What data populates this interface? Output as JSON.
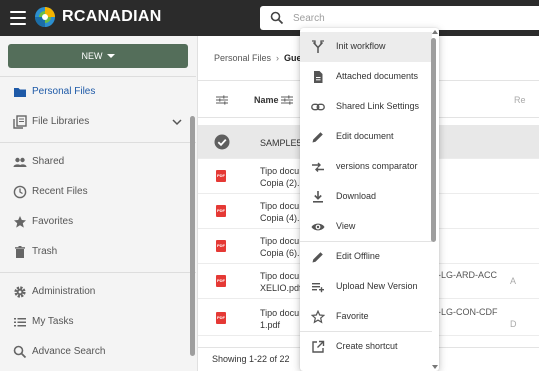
{
  "colors": {
    "header_bg": "#2b2b2b",
    "new_button_bg": "#546e5a",
    "active_nav": "#1e5aa8",
    "pdf_red": "#e53935"
  },
  "header": {
    "brand": "RCANADIAN",
    "search_placeholder": "Search"
  },
  "sidebar": {
    "new_button": "NEW",
    "items": [
      {
        "label": "Personal Files",
        "icon": "folder-icon",
        "active": true
      },
      {
        "label": "File Libraries",
        "icon": "library-icon",
        "expandable": true
      },
      {
        "label": "Shared",
        "icon": "people-icon"
      },
      {
        "label": "Recent Files",
        "icon": "clock-icon"
      },
      {
        "label": "Favorites",
        "icon": "star-icon"
      },
      {
        "label": "Trash",
        "icon": "trash-icon"
      },
      {
        "label": "Administration",
        "icon": "gear-icon"
      },
      {
        "label": "My Tasks",
        "icon": "task-list-icon"
      },
      {
        "label": "Advance Search",
        "icon": "search-icon"
      }
    ]
  },
  "content": {
    "breadcrumb": {
      "root": "Personal Files",
      "current": "Gue"
    },
    "table": {
      "header_name": "Name",
      "header_right": "Re",
      "rows": [
        {
          "name_line1": "SAMPLE5",
          "name_line2": "",
          "extra": "",
          "letter": "",
          "selected": true
        },
        {
          "name_line1": "Tipo docu",
          "name_line2": "Copia (2).p",
          "extra": "",
          "letter": ""
        },
        {
          "name_line1": "Tipo docu",
          "name_line2": "Copia (4).p",
          "extra": "",
          "letter": ""
        },
        {
          "name_line1": "Tipo docu",
          "name_line2": "Copia (6).p",
          "extra": "",
          "letter": ""
        },
        {
          "name_line1": "Tipo docu",
          "name_line2": "XELIO.pdf",
          "extra": "-LG-ARD-ACC",
          "letter": "A"
        },
        {
          "name_line1": "Tipo docu",
          "name_line2": "1.pdf",
          "extra": "-LG-CON-CDF",
          "letter": "D"
        }
      ]
    },
    "footer": "Showing 1-22 of 22"
  },
  "context_menu": {
    "items": [
      {
        "label": "Init workflow",
        "icon": "workflow-fork-icon"
      },
      {
        "label": "Attached documents",
        "icon": "document-icon"
      },
      {
        "label": "Shared Link Settings",
        "icon": "link-icon"
      },
      {
        "label": "Edit document",
        "icon": "pencil-icon"
      },
      {
        "label": "versions comparator",
        "icon": "compare-arrows-icon"
      },
      {
        "label": "Download",
        "icon": "download-icon"
      },
      {
        "label": "View",
        "icon": "eye-icon"
      },
      {
        "label": "Edit Offline",
        "icon": "pencil-icon"
      },
      {
        "label": "Upload New Version",
        "icon": "playlist-add-icon"
      },
      {
        "label": "Favorite",
        "icon": "star-outline-icon"
      },
      {
        "label": "Create shortcut",
        "icon": "open-in-new-icon"
      }
    ]
  }
}
